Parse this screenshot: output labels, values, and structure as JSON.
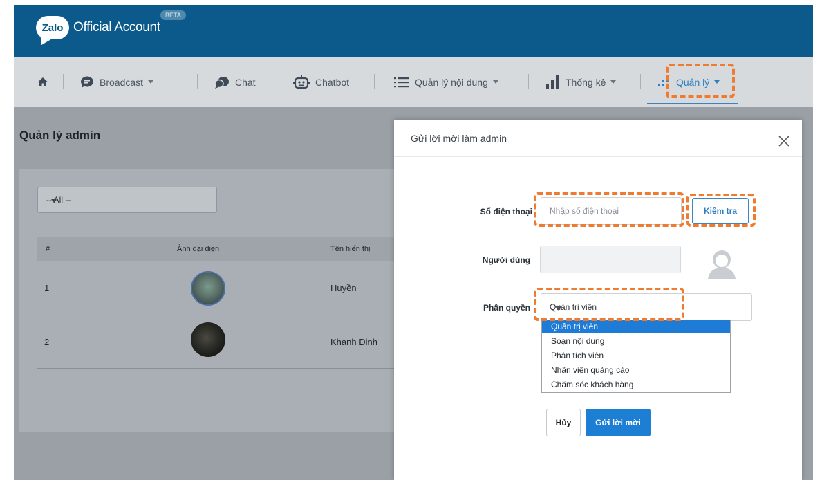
{
  "colors": {
    "appbar": "#0b5a8b",
    "primary": "#1c7fd4",
    "annotation": "#ee7b30",
    "selected_option": "#1f7cd6"
  },
  "app": {
    "logo": "Zalo",
    "title": "Official Account",
    "badge": "BETA"
  },
  "nav": {
    "items": [
      {
        "label": "",
        "icon": "home-icon"
      },
      {
        "label": "Broadcast",
        "icon": "message-bubble-icon",
        "dropdown": true
      },
      {
        "label": "Chat",
        "icon": "chat-bubbles-icon"
      },
      {
        "label": "Chatbot",
        "icon": "robot-icon"
      },
      {
        "label": "Quản lý nội dung",
        "icon": "list-icon",
        "dropdown": true
      },
      {
        "label": "Thống kê",
        "icon": "bar-chart-icon",
        "dropdown": true
      },
      {
        "label": "Quản lý",
        "icon": "grid-dots-icon",
        "dropdown": true,
        "active": true
      }
    ]
  },
  "page": {
    "title": "Quản lý admin",
    "filter": {
      "value": "-- All --"
    },
    "table": {
      "columns": [
        "#",
        "Ảnh đại diện",
        "Tên hiển thị"
      ],
      "rows": [
        {
          "index": "1",
          "name": "Huyền"
        },
        {
          "index": "2",
          "name": "Khanh Đinh"
        }
      ]
    }
  },
  "modal": {
    "title": "Gửi lời mời làm admin",
    "phone_label": "Số điện thoại",
    "phone_placeholder": "Nhập số điện thoại",
    "check_button": "Kiểm tra",
    "user_label": "Người dùng",
    "role_label": "Phân quyền",
    "role_selected": "Quản trị viên",
    "role_options": [
      "Quản trị viên",
      "Soạn nội dung",
      "Phân tích viên",
      "Nhân viên quảng cáo",
      "Chăm sóc khách hàng"
    ],
    "cancel_button": "Hủy",
    "send_button": "Gửi lời mời"
  }
}
